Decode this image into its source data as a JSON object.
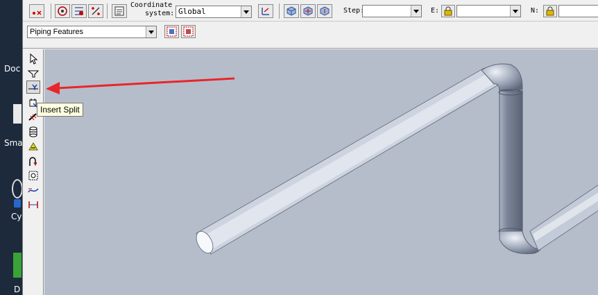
{
  "desktop": {
    "items": [
      {
        "label": "Doc"
      },
      {
        "label": "Sma"
      },
      {
        "label": "Cy"
      },
      {
        "label": "D"
      }
    ]
  },
  "toolbar": {
    "coordinate_system_label_line1": "Coordinate",
    "coordinate_system_label_line2": "system:",
    "coordinate_system_value": "Global",
    "step_label": "Step:",
    "step_value": "",
    "e_label": "E:",
    "e_value": "",
    "n_label": "N:",
    "n_value": ""
  },
  "toolbar2": {
    "feature_set_value": "Piping Features"
  },
  "tooltip": {
    "text": "Insert Split"
  },
  "colors": {
    "viewport_background": "#b6bdca",
    "pipe": "#c9d1de",
    "annotation_arrow": "#e8262a",
    "tooltip_background": "#ffffe1"
  }
}
